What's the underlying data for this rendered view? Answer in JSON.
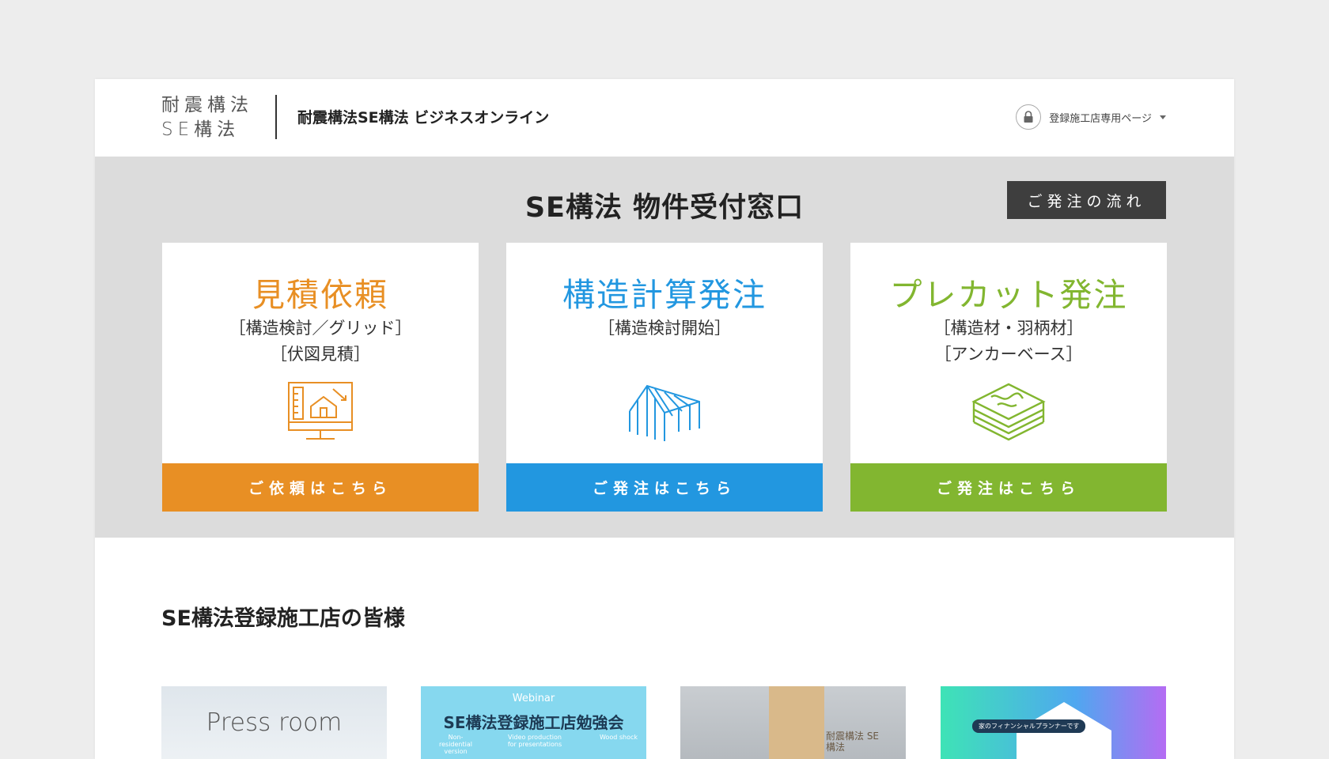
{
  "header": {
    "logo_line1": "耐震構法",
    "logo_line2": "SE構法",
    "site_title": "耐震構法SE構法 ビジネスオンライン",
    "member_menu_label": "登録施工店専用ページ"
  },
  "window": {
    "title": "SE構法 物件受付窓口",
    "flow_button_label": "ご発注の流れ"
  },
  "cards": [
    {
      "title": "見積依頼",
      "sub1": "［構造検討／グリッド］",
      "sub2": "［伏図見積］",
      "cta": "ご依頼はこちら",
      "icon": "blueprint-house-icon",
      "color": "#e88f24"
    },
    {
      "title": "構造計算発注",
      "sub1": "［構造検討開始］",
      "sub2": "",
      "cta": "ご発注はこちら",
      "icon": "frame-structure-icon",
      "color": "#2297e0"
    },
    {
      "title": "プレカット発注",
      "sub1": "［構造材・羽柄材］",
      "sub2": "［アンカーベース］",
      "cta": "ご発注はこちら",
      "icon": "wood-layers-icon",
      "color": "#82b630"
    }
  ],
  "members": {
    "heading": "SE構法登録施工店の皆様",
    "thumbnails": [
      {
        "text1": "Press room"
      },
      {
        "text1": "Webinar",
        "text2": "SE構法登録施工店勉強会",
        "m1": "Non-residential version",
        "m2": "Video production for presentations",
        "m3": "Wood shock"
      },
      {
        "text1": "耐震構法 SE構法"
      },
      {
        "text1": "家のフィナンシャルプランナーです"
      }
    ]
  }
}
